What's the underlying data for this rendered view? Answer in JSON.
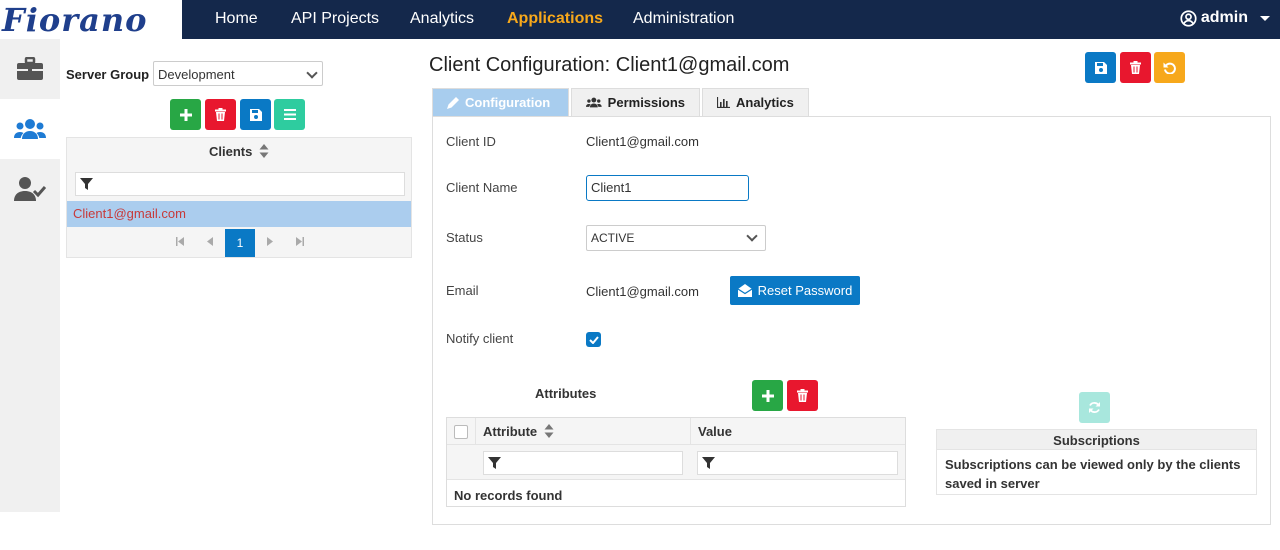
{
  "app": {
    "logo": "Fiorano"
  },
  "nav": {
    "items": [
      "Home",
      "API Projects",
      "Analytics",
      "Applications",
      "Administration"
    ],
    "active": "Applications"
  },
  "user": {
    "name": "admin"
  },
  "sidebar": {
    "items": [
      "briefcase-icon",
      "users-icon",
      "user-check-icon"
    ]
  },
  "server_group": {
    "label": "Server Group",
    "value": "Development"
  },
  "clients": {
    "header": "Clients",
    "rows": [
      "Client1@gmail.com"
    ],
    "page": "1"
  },
  "page": {
    "title": "Client Configuration: Client1@gmail.com"
  },
  "tabs": {
    "configuration": "Configuration",
    "permissions": "Permissions",
    "analytics": "Analytics"
  },
  "form": {
    "client_id_label": "Client ID",
    "client_id": "Client1@gmail.com",
    "client_name_label": "Client Name",
    "client_name": "Client1",
    "status_label": "Status",
    "status": "ACTIVE",
    "email_label": "Email",
    "email": "Client1@gmail.com",
    "reset_label": "Reset Password",
    "notify_label": "Notify client",
    "notify": true
  },
  "attributes": {
    "label": "Attributes",
    "col_attribute": "Attribute",
    "col_value": "Value",
    "empty": "No records found"
  },
  "subscriptions": {
    "header": "Subscriptions",
    "message": "Subscriptions can be viewed only by the clients saved in server"
  },
  "colors": {
    "navbar": "#14284b",
    "accent": "#f7a81b",
    "primary": "#0a79c5",
    "success": "#28a745",
    "danger": "#e8172e"
  }
}
